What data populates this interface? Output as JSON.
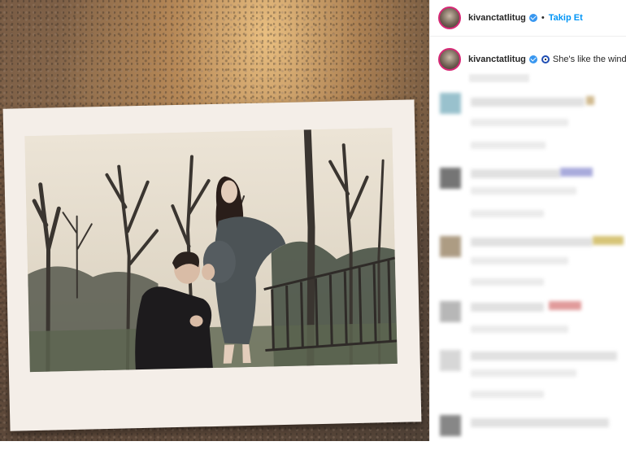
{
  "post": {
    "username": "kivanctatlitug",
    "separator": "•",
    "follow_label": "Takip Et",
    "caption": "She's like the wind",
    "colors": {
      "accent": "#0095f6",
      "verified": "#3897f0",
      "story_ring": "#d62976"
    }
  },
  "icons": {
    "verified": "verified-badge-icon",
    "nazar": "nazar-evil-eye-icon"
  },
  "comments": {
    "state": "blurred",
    "count": 6
  }
}
